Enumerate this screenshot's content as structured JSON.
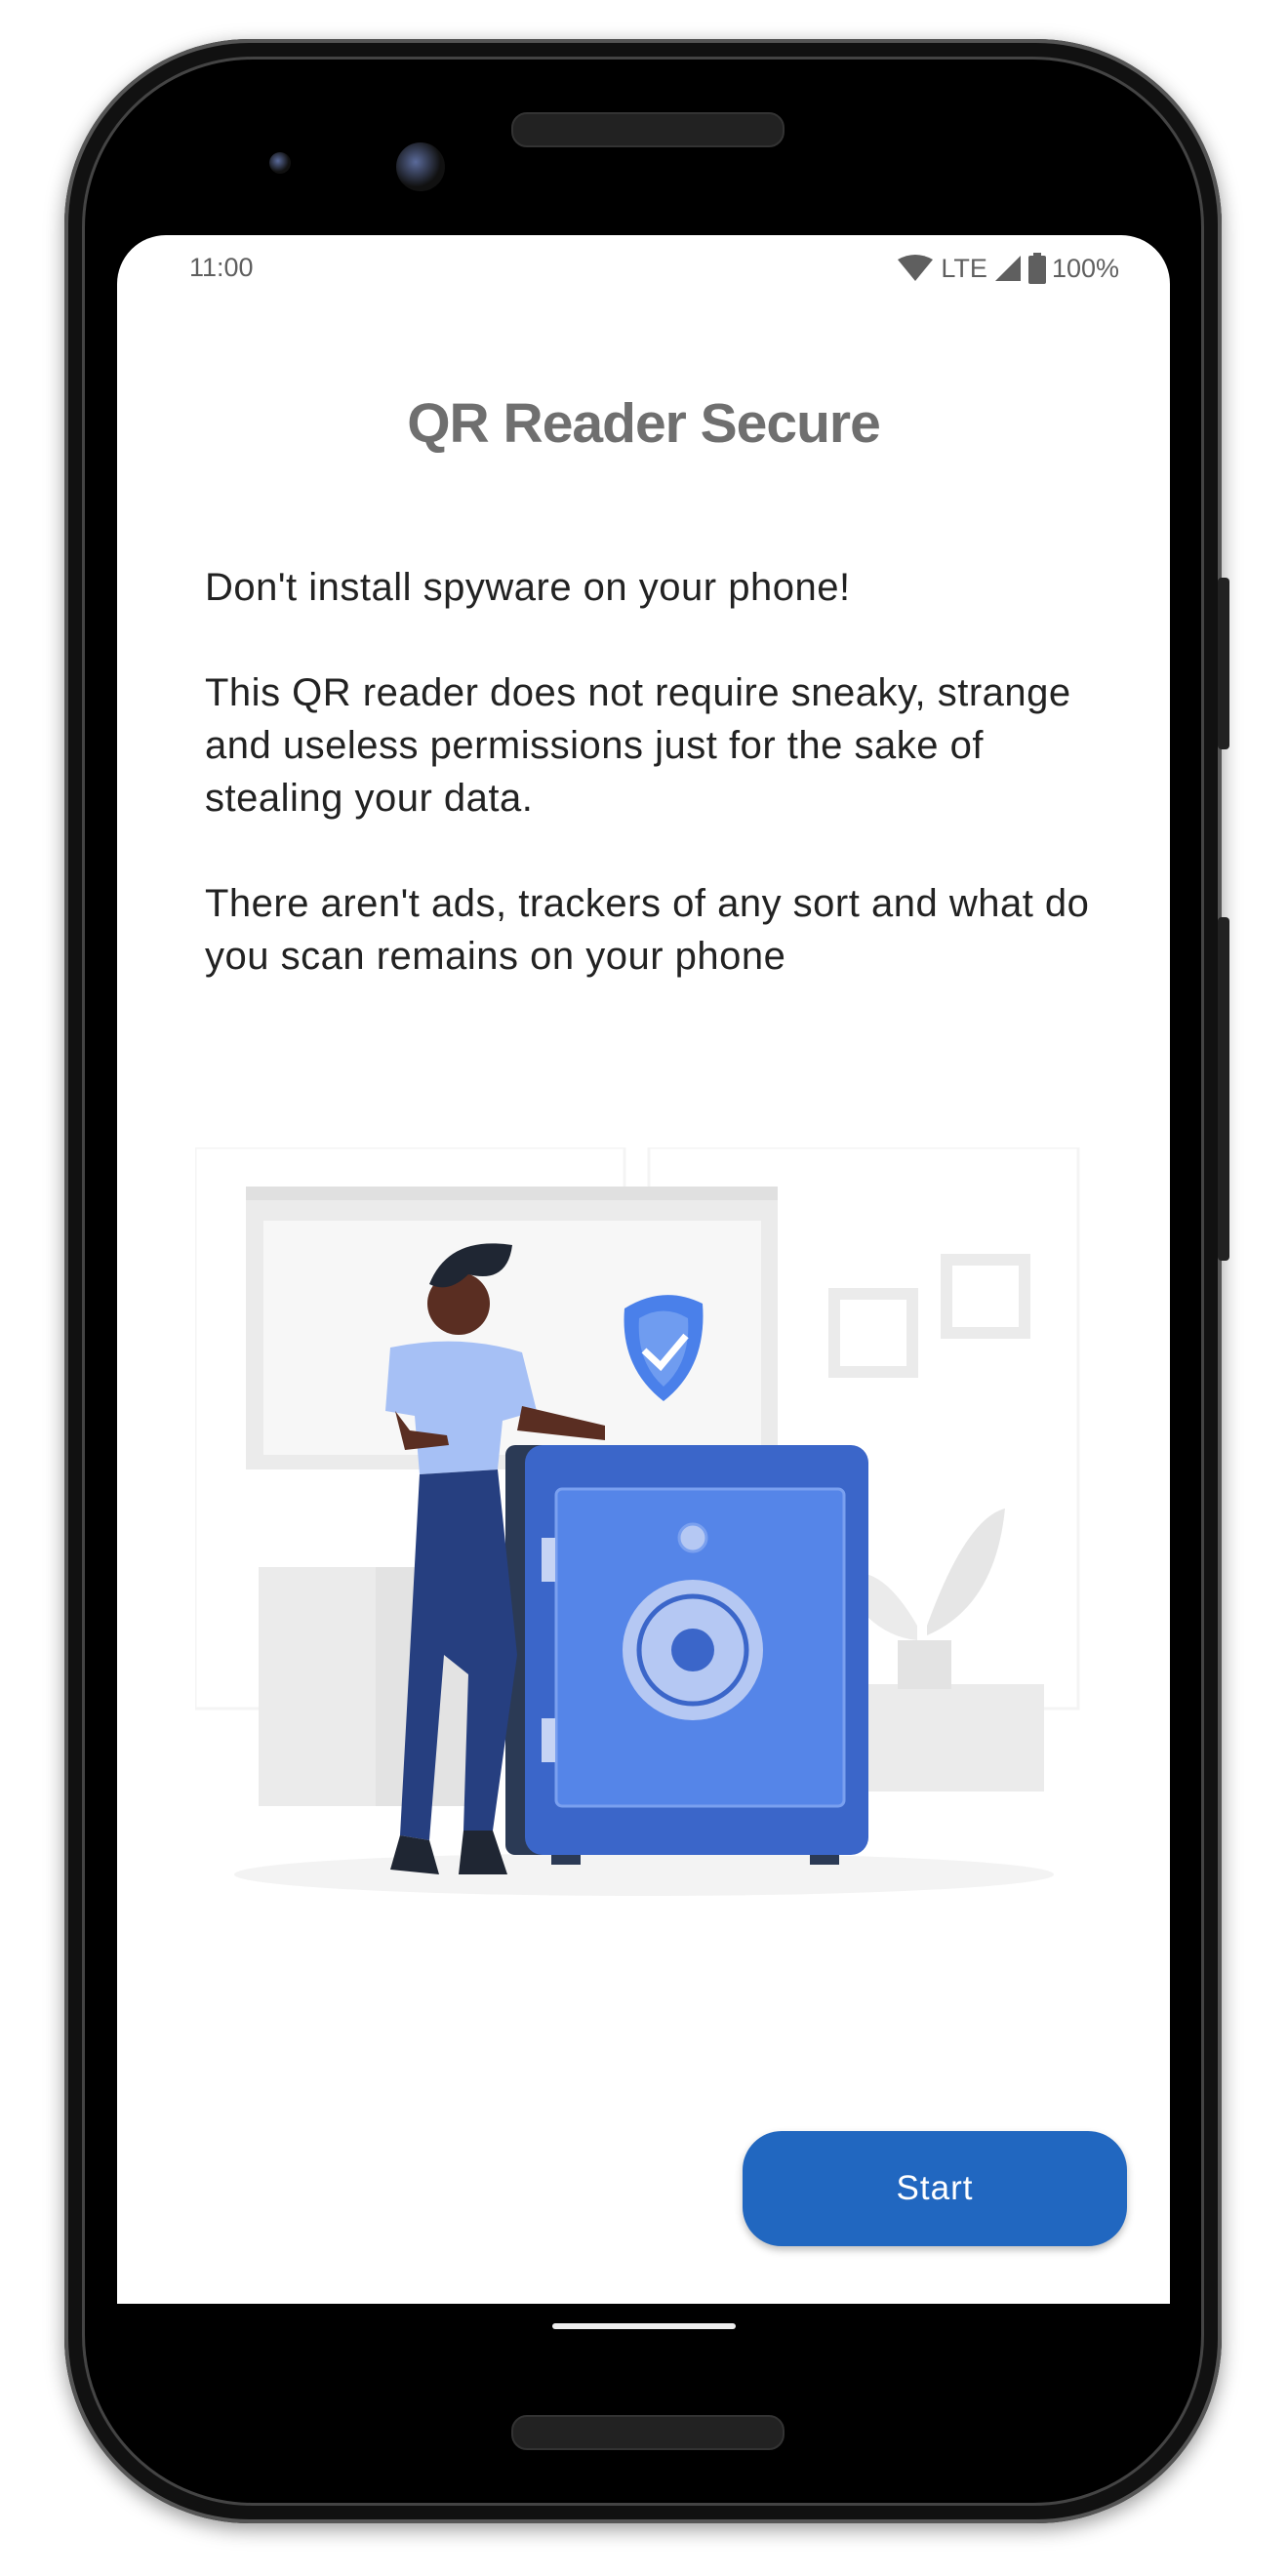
{
  "status_bar": {
    "time": "11:00",
    "network": "LTE",
    "battery": "100%"
  },
  "title": "QR Reader Secure",
  "paragraphs": [
    "Don't install spyware on your phone!",
    "This QR reader does not require sneaky, strange and useless permissions just for the sake of stealing your data.",
    "There aren't ads, trackers of any sort and what do you scan remains on your phone"
  ],
  "start_button": "Start",
  "colors": {
    "accent": "#2167c0",
    "title": "#6f6f6f",
    "safe": "#3b66c9"
  }
}
